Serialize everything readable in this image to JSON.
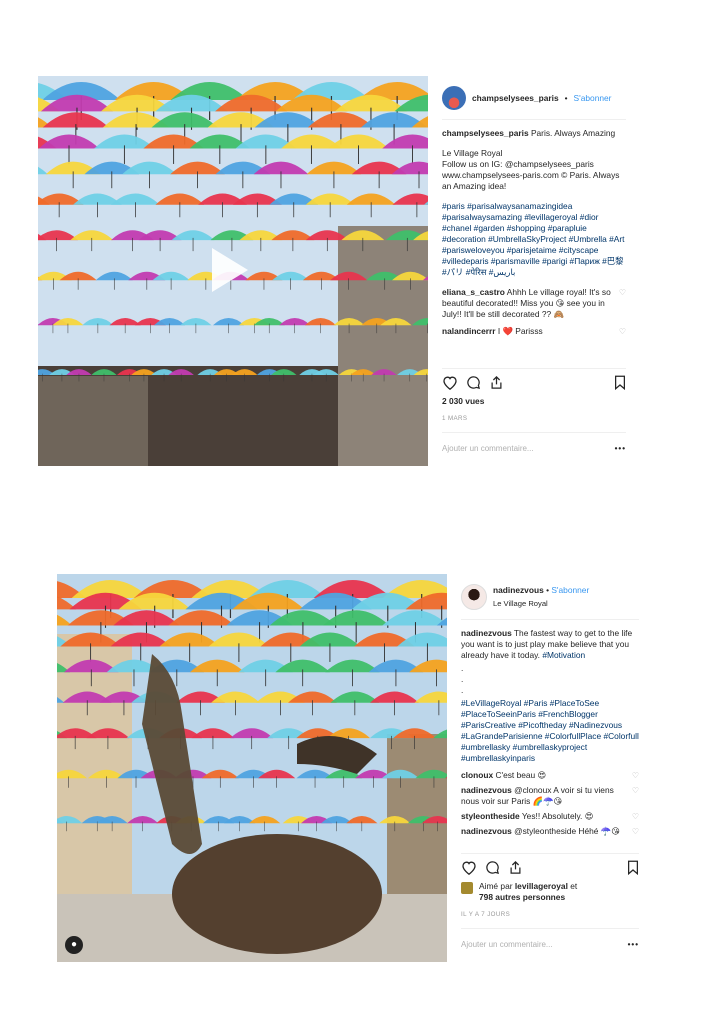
{
  "post1": {
    "username": "champselysees_paris",
    "follow": "S'abonner",
    "caption_user": "champselysees_paris",
    "caption_first": "Paris. Always Amazing",
    "caption_lines": [
      "Le Village Royal",
      "Follow us on IG: @champselysees_paris",
      "www.champselysees-paris.com © Paris. Always an Amazing idea!"
    ],
    "hashtags": "#paris #parisalwaysanamazingidea #parisalwaysamazing #levillageroyal #dior #chanel #garden #shopping #parapluie #decoration #UmbrellaSkyProject #Umbrella #Art #parisweloveyou #parisjetaime #cityscape #villedeparis #parismaville #parigi #Париж #巴黎 #パリ #पेरिस #باريس",
    "comments": [
      {
        "user": "eliana_s_castro",
        "text": "Ahhh Le village royal! It's so beautiful decorated!! Miss you 😘 see you in July!! It'll be still decorated ?? 🙈"
      },
      {
        "user": "nalandincerrr",
        "text": "I ❤️ Parisss"
      }
    ],
    "views": "2 030 vues",
    "date": "1 MARS",
    "add_comment": "Ajouter un commentaire...",
    "more": "•••",
    "icons": [
      "heart-icon",
      "comment-icon",
      "share-icon",
      "bookmark-icon",
      "play-icon"
    ]
  },
  "post2": {
    "username": "nadinezvous",
    "follow": "S'abonner",
    "location": "Le Village Royal",
    "caption_user": "nadinezvous",
    "caption_text": "The fastest way to get to the life you want is to just play make believe that you already have it today.",
    "caption_tag": "#Motivation",
    "dots": [
      ".",
      ".",
      "."
    ],
    "hashtags": "#LeVillageRoyal #Paris #PlaceToSee #PlaceToSeeinParis #FrenchBlogger #ParisCreative #Picoftheday #Nadinezvous #LaGrandeParisienne #ColorfullPlace #Colorfull #umbrellasky #umbrellaskyproject #umbrellaskyinparis",
    "comments": [
      {
        "user": "clonoux",
        "text": "C'est beau 😍"
      },
      {
        "user": "nadinezvous",
        "text": "@clonoux A voir si tu viens nous voir sur Paris 🌈☂️😘"
      },
      {
        "user": "styleontheside",
        "text": "Yes!! Absolutely. 😍"
      },
      {
        "user": "nadinezvous",
        "text": "@styleontheside Héhé ☂️😘"
      }
    ],
    "liked_prefix": "Aimé par",
    "liked_user": "levillageroyal",
    "liked_and": "et",
    "liked_rest": "798 autres personnes",
    "date": "IL Y A 7 JOURS",
    "add_comment": "Ajouter un commentaire...",
    "more": "•••"
  },
  "colors": {
    "link": "#3897f0",
    "hashtag": "#003569",
    "umbrellas": [
      "#e8344e",
      "#f4a21f",
      "#f7d63c",
      "#4fa3e0",
      "#3fbf6a",
      "#c23bb0",
      "#ef6a2a",
      "#6fd0e6"
    ]
  }
}
